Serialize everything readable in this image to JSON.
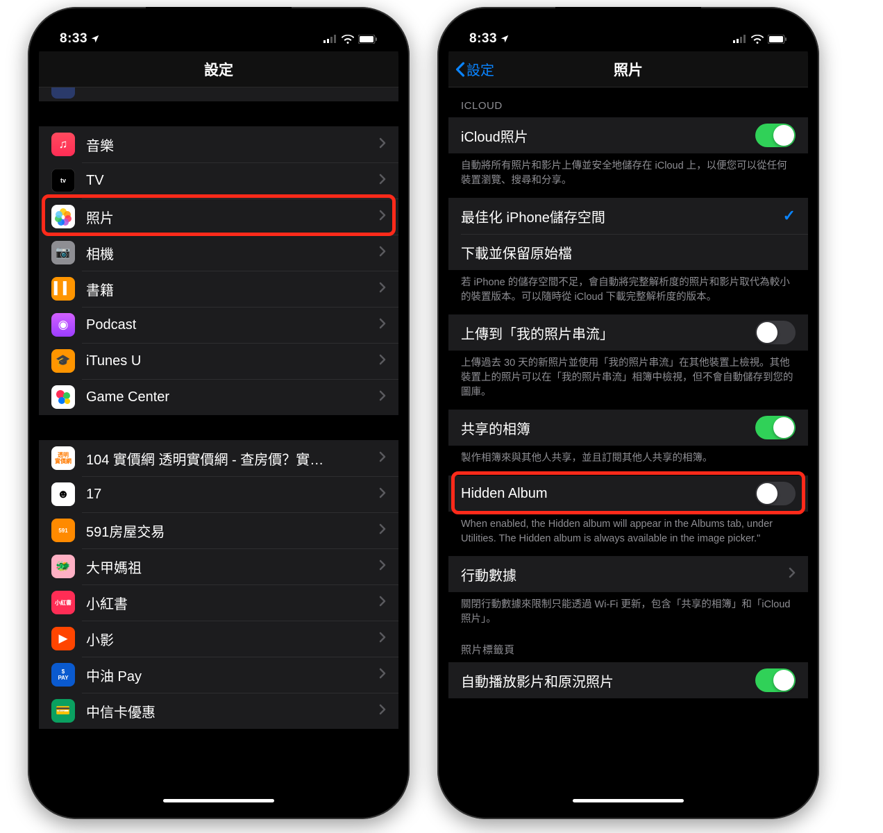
{
  "status": {
    "time": "8:33",
    "arrow": "↗"
  },
  "left": {
    "title": "設定",
    "group1": [
      {
        "icon": "music",
        "bg": "linear-gradient(#ff4a5e,#ff2d55)",
        "label": "音樂",
        "glyph": "♫"
      },
      {
        "icon": "tv",
        "bg": "#000",
        "label": "TV",
        "glyph": "tv",
        "border": true
      },
      {
        "icon": "photos",
        "bg": "#fff",
        "label": "照片",
        "glyph": "photos",
        "highlight": true
      },
      {
        "icon": "camera",
        "bg": "#8e8e93",
        "label": "相機",
        "glyph": "📷"
      },
      {
        "icon": "books",
        "bg": "#ff9500",
        "label": "書籍",
        "glyph": "▍▍"
      },
      {
        "icon": "podcast",
        "bg": "linear-gradient(#d260ff,#9b3dff)",
        "label": "Podcast",
        "glyph": "◉"
      },
      {
        "icon": "itunesu",
        "bg": "#ff9500",
        "label": "iTunes U",
        "glyph": "🎓"
      },
      {
        "icon": "gamecenter",
        "bg": "#fff",
        "label": "Game Center",
        "glyph": "gc"
      }
    ],
    "group2": [
      {
        "icon": "app1",
        "bg": "#fff",
        "label": "104 實價網 透明實價網 - 查房價？實…",
        "text": "透明\n實價網",
        "fg": "#ff7a00"
      },
      {
        "icon": "app2",
        "bg": "#fff",
        "label": "17",
        "glyph": "☻",
        "fg": "#000"
      },
      {
        "icon": "app3",
        "bg": "#ff8a00",
        "label": "591房屋交易",
        "text": "591"
      },
      {
        "icon": "app4",
        "bg": "#ffb0c4",
        "label": "大甲媽祖",
        "glyph": "🐲"
      },
      {
        "icon": "app5",
        "bg": "#ff2d55",
        "label": "小紅書",
        "text": "小紅書"
      },
      {
        "icon": "app6",
        "bg": "#ff4500",
        "label": "小影",
        "glyph": "▶"
      },
      {
        "icon": "app7",
        "bg": "#0a5acf",
        "label": "中油 Pay",
        "text": "$\nPAY"
      },
      {
        "icon": "app8",
        "bg": "#0aa060",
        "label": "中信卡優惠",
        "glyph": "💳"
      }
    ]
  },
  "right": {
    "back": "設定",
    "title": "照片",
    "section1_header": "ICLOUD",
    "icloud_photos": "iCloud照片",
    "icloud_footer": "自動將所有照片和影片上傳並安全地儲存在 iCloud 上，以便您可以從任何裝置瀏覽、搜尋和分享。",
    "optimize": "最佳化 iPhone儲存空間",
    "download": "下載並保留原始檔",
    "storage_footer": "若 iPhone 的儲存空間不足，會自動將完整解析度的照片和影片取代為較小的裝置版本。可以隨時從 iCloud 下載完整解析度的版本。",
    "mystream": "上傳到「我的照片串流」",
    "mystream_footer": "上傳過去 30 天的新照片並使用「我的照片串流」在其他裝置上檢視。其他裝置上的照片可以在「我的照片串流」相簿中檢視，但不會自動儲存到您的圖庫。",
    "shared": "共享的相簿",
    "shared_footer": "製作相簿來與其他人共享，並且訂閱其他人共享的相簿。",
    "hidden": "Hidden Album",
    "hidden_footer": "When enabled, the Hidden album will appear in the Albums tab, under Utilities. The Hidden album is always available in the image picker.\"",
    "cellular": "行動數據",
    "cellular_footer": "關閉行動數據來限制只能透過 Wi-Fi 更新，包含「共享的相簿」和「iCloud照片」。",
    "tags_header": "照片標籤頁",
    "autoplay": "自動播放影片和原況照片"
  }
}
